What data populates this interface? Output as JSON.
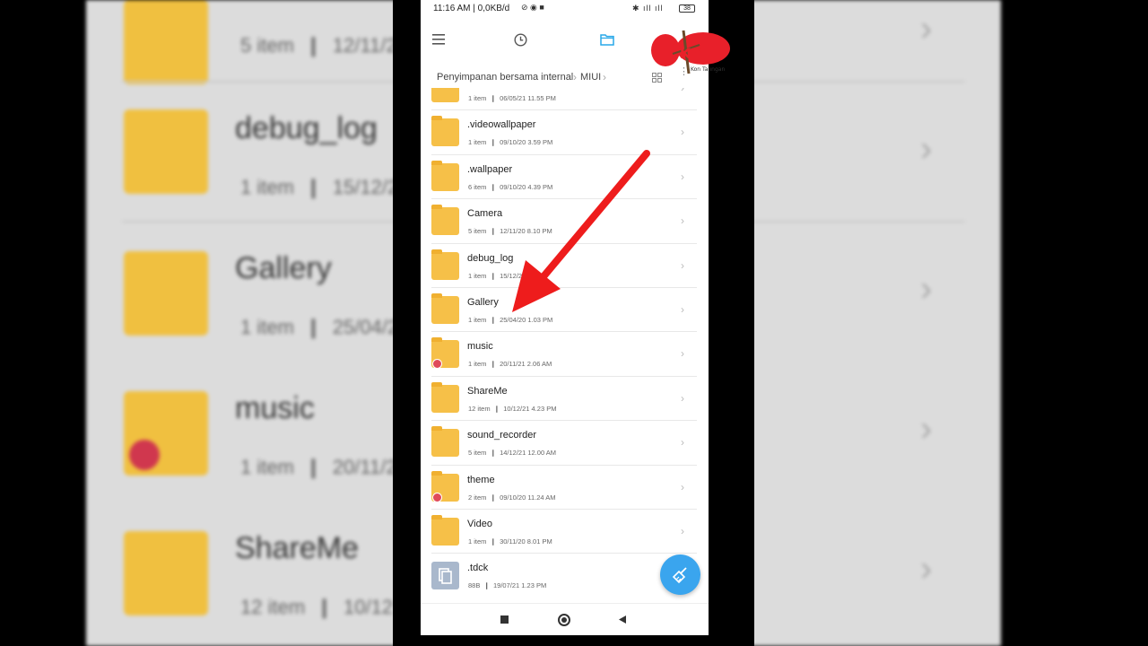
{
  "status_bar": {
    "text": "11:16 AM | 0,0KB/d",
    "battery": "38"
  },
  "toolbar": {
    "menu_icon": "hamburger-icon",
    "recent_icon": "clock-icon",
    "folder_icon": "folder-icon",
    "accent": "#29a8e8"
  },
  "breadcrumb": {
    "items": [
      "Penyimpanan bersama internal",
      "MIUI"
    ]
  },
  "logo": {
    "text": "KM",
    "subtext": "Kon Tanngan",
    "color": "#e8202a"
  },
  "files": [
    {
      "name": "",
      "count": "1 item",
      "date": "06/05/21 11.55 PM",
      "type": "folder"
    },
    {
      "name": ".videowallpaper",
      "count": "1 item",
      "date": "09/10/20 3.59 PM",
      "type": "folder"
    },
    {
      "name": ".wallpaper",
      "count": "6 item",
      "date": "09/10/20 4.39 PM",
      "type": "folder"
    },
    {
      "name": "Camera",
      "count": "5 item",
      "date": "12/11/20 8.10 PM",
      "type": "folder"
    },
    {
      "name": "debug_log",
      "count": "1 item",
      "date": "15/12/21",
      "type": "folder"
    },
    {
      "name": "Gallery",
      "count": "1 item",
      "date": "25/04/20 1.03 PM",
      "type": "folder"
    },
    {
      "name": "music",
      "count": "1 item",
      "date": "20/11/21 2.06 AM",
      "type": "folder",
      "badge": true
    },
    {
      "name": "ShareMe",
      "count": "12 item",
      "date": "10/12/21 4.23 PM",
      "type": "folder"
    },
    {
      "name": "sound_recorder",
      "count": "5 item",
      "date": "14/12/21 12.00 AM",
      "type": "folder"
    },
    {
      "name": "theme",
      "count": "2 item",
      "date": "09/10/20 11.24 AM",
      "type": "folder",
      "badge": true
    },
    {
      "name": "Video",
      "count": "1 item",
      "date": "30/11/20 8.01 PM",
      "type": "folder"
    },
    {
      "name": ".tdck",
      "count": "88B",
      "date": "19/07/21 1.23 PM",
      "type": "file"
    }
  ],
  "background": {
    "rows": [
      {
        "name": "",
        "count": "5 item",
        "date": "12/11/2"
      },
      {
        "name": "debug_log",
        "count": "1 item",
        "date": "15/12/2"
      },
      {
        "name": "Gallery",
        "count": "1 item",
        "date": "25/04/2"
      },
      {
        "name": "music",
        "count": "1 item",
        "date": "20/11/2"
      },
      {
        "name": "ShareMe",
        "count": "12 item",
        "date": "10/12"
      }
    ]
  },
  "fab": {
    "icon": "broom-icon",
    "color": "#3aa5ee"
  },
  "nav": {
    "recent_icon": "square-icon",
    "home_icon": "circle-icon",
    "back_icon": "triangle-back-icon"
  },
  "annotation": {
    "arrow_color": "#ee1c1c"
  }
}
